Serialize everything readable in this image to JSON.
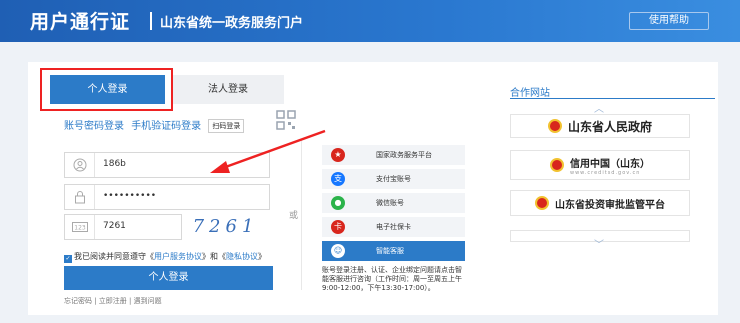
{
  "header": {
    "brand": "用户通行证",
    "portal": "山东省统一政务服务门户",
    "help_label": "使用帮助"
  },
  "login": {
    "tab_personal": "个人登录",
    "tab_legal": "法人登录",
    "subtab_account": "账号密码登录",
    "subtab_sms": "手机验证码登录",
    "subtab_scan": "扫码登录",
    "username_value": "186b",
    "password_value": "••••••••••",
    "captcha_input_value": "7261",
    "captcha_image_text": "7261",
    "agree_prefix": "我已阅读并同意遵守《",
    "agree_link1": "用户服务协议",
    "agree_mid": "》和《",
    "agree_link2": "隐私协议",
    "agree_suffix": "》",
    "login_button": "个人登录",
    "bottom_links": "忘记密码 | 立即注册 | 遇到问题",
    "or_label": "或"
  },
  "alt_login": {
    "items": [
      {
        "label": "国家政务服务平台",
        "icon": "national-emblem-icon"
      },
      {
        "label": "支付宝账号",
        "icon": "alipay-icon"
      },
      {
        "label": "微信账号",
        "icon": "wechat-icon"
      },
      {
        "label": "电子社保卡",
        "icon": "social-security-card-icon"
      },
      {
        "label": "智能客服",
        "icon": "customer-service-icon"
      }
    ],
    "service_note": "账号登录注册、认证、企业绑定问题请点击智能客服进行咨询（工作时间：周一至周五上午9:00-12:00，下午13:30-17:00）。"
  },
  "cooperation": {
    "title": "合作网站",
    "sites": [
      {
        "label": "山东省人民政府"
      },
      {
        "label": "信用中国（山东）",
        "sub": "www.creditsd.gov.cn"
      },
      {
        "label": "山东省投资审批监管平台"
      }
    ]
  },
  "colors": {
    "header_blue": "#2a78d0",
    "accent_blue": "#2c7bc8",
    "annotation_red": "#e22222"
  }
}
